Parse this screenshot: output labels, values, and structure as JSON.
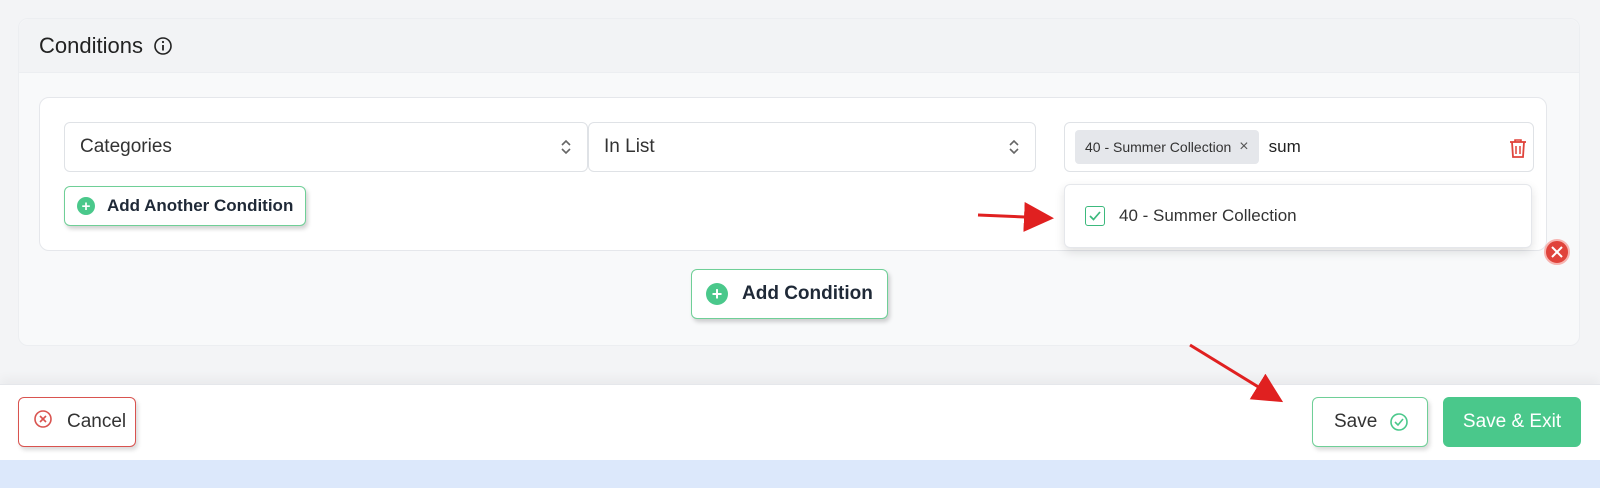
{
  "conditions_card": {
    "title": "Conditions",
    "info_icon": "info-circle-icon"
  },
  "condition_row": {
    "field_select": {
      "value": "Categories",
      "icon": "chevron-up-down-icon"
    },
    "operator_select": {
      "value": "In List",
      "icon": "chevron-up-down-icon"
    },
    "values_input": {
      "selected_tags": [
        {
          "label": "40 - Summer Collection",
          "remove_icon": "close-icon"
        }
      ],
      "typed_text": "sum"
    },
    "delete_icon": "trash-icon",
    "add_another_label": "Add Another Condition"
  },
  "dropdown": {
    "options": [
      {
        "label": "40 - Summer Collection",
        "checked": true
      }
    ]
  },
  "add_condition_label": "Add Condition",
  "footer": {
    "cancel_label": "Cancel",
    "save_label": "Save",
    "save_exit_label": "Save & Exit"
  },
  "colors": {
    "accent_green": "#4ac88b",
    "danger_red": "#d9534f",
    "annotation_arrow": "#e02020"
  }
}
